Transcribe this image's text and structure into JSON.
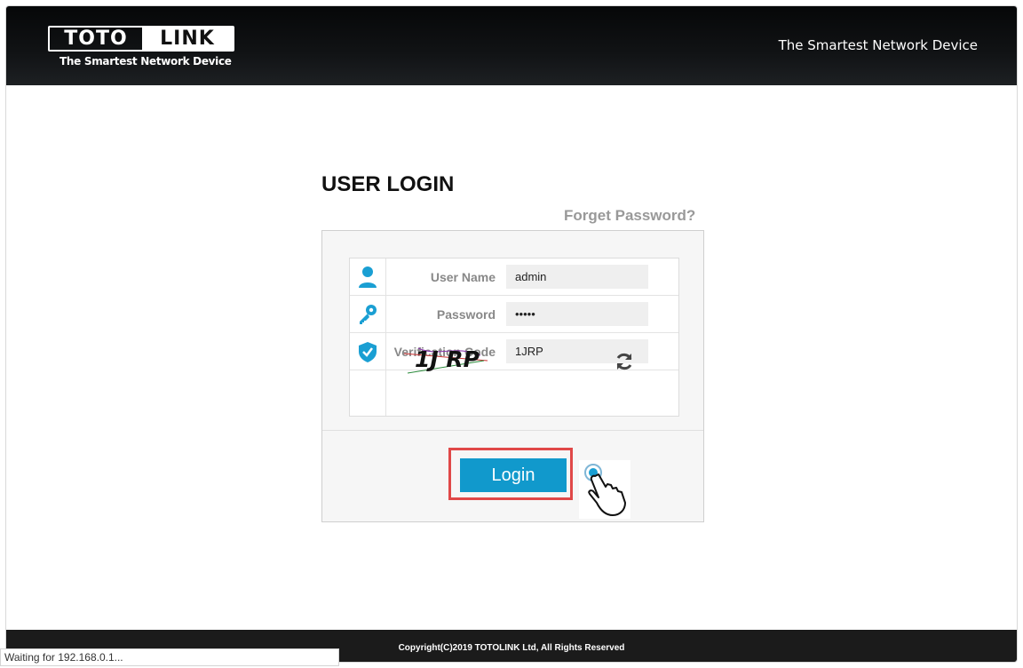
{
  "header": {
    "logo_left": "TOTO",
    "logo_right": "LINK",
    "logo_tagline": "The Smartest Network Device",
    "slogan": "The Smartest Network Device"
  },
  "login": {
    "title": "USER LOGIN",
    "forget_password": "Forget Password?",
    "fields": {
      "username_label": "User Name",
      "username_value": "admin",
      "password_label": "Password",
      "password_value": "•••••",
      "verification_label": "Verification Code",
      "verification_value": "1JRP"
    },
    "captcha_text": "1J RP",
    "login_button": "Login"
  },
  "footer": {
    "copyright": "Copyright(C)2019 TOTOLINK Ltd, All Rights Reserved"
  },
  "status_bar": {
    "text": "Waiting for 192.168.0.1..."
  },
  "colors": {
    "accent": "#1199cc",
    "icon": "#1a9fd3",
    "highlight": "#e04848"
  }
}
